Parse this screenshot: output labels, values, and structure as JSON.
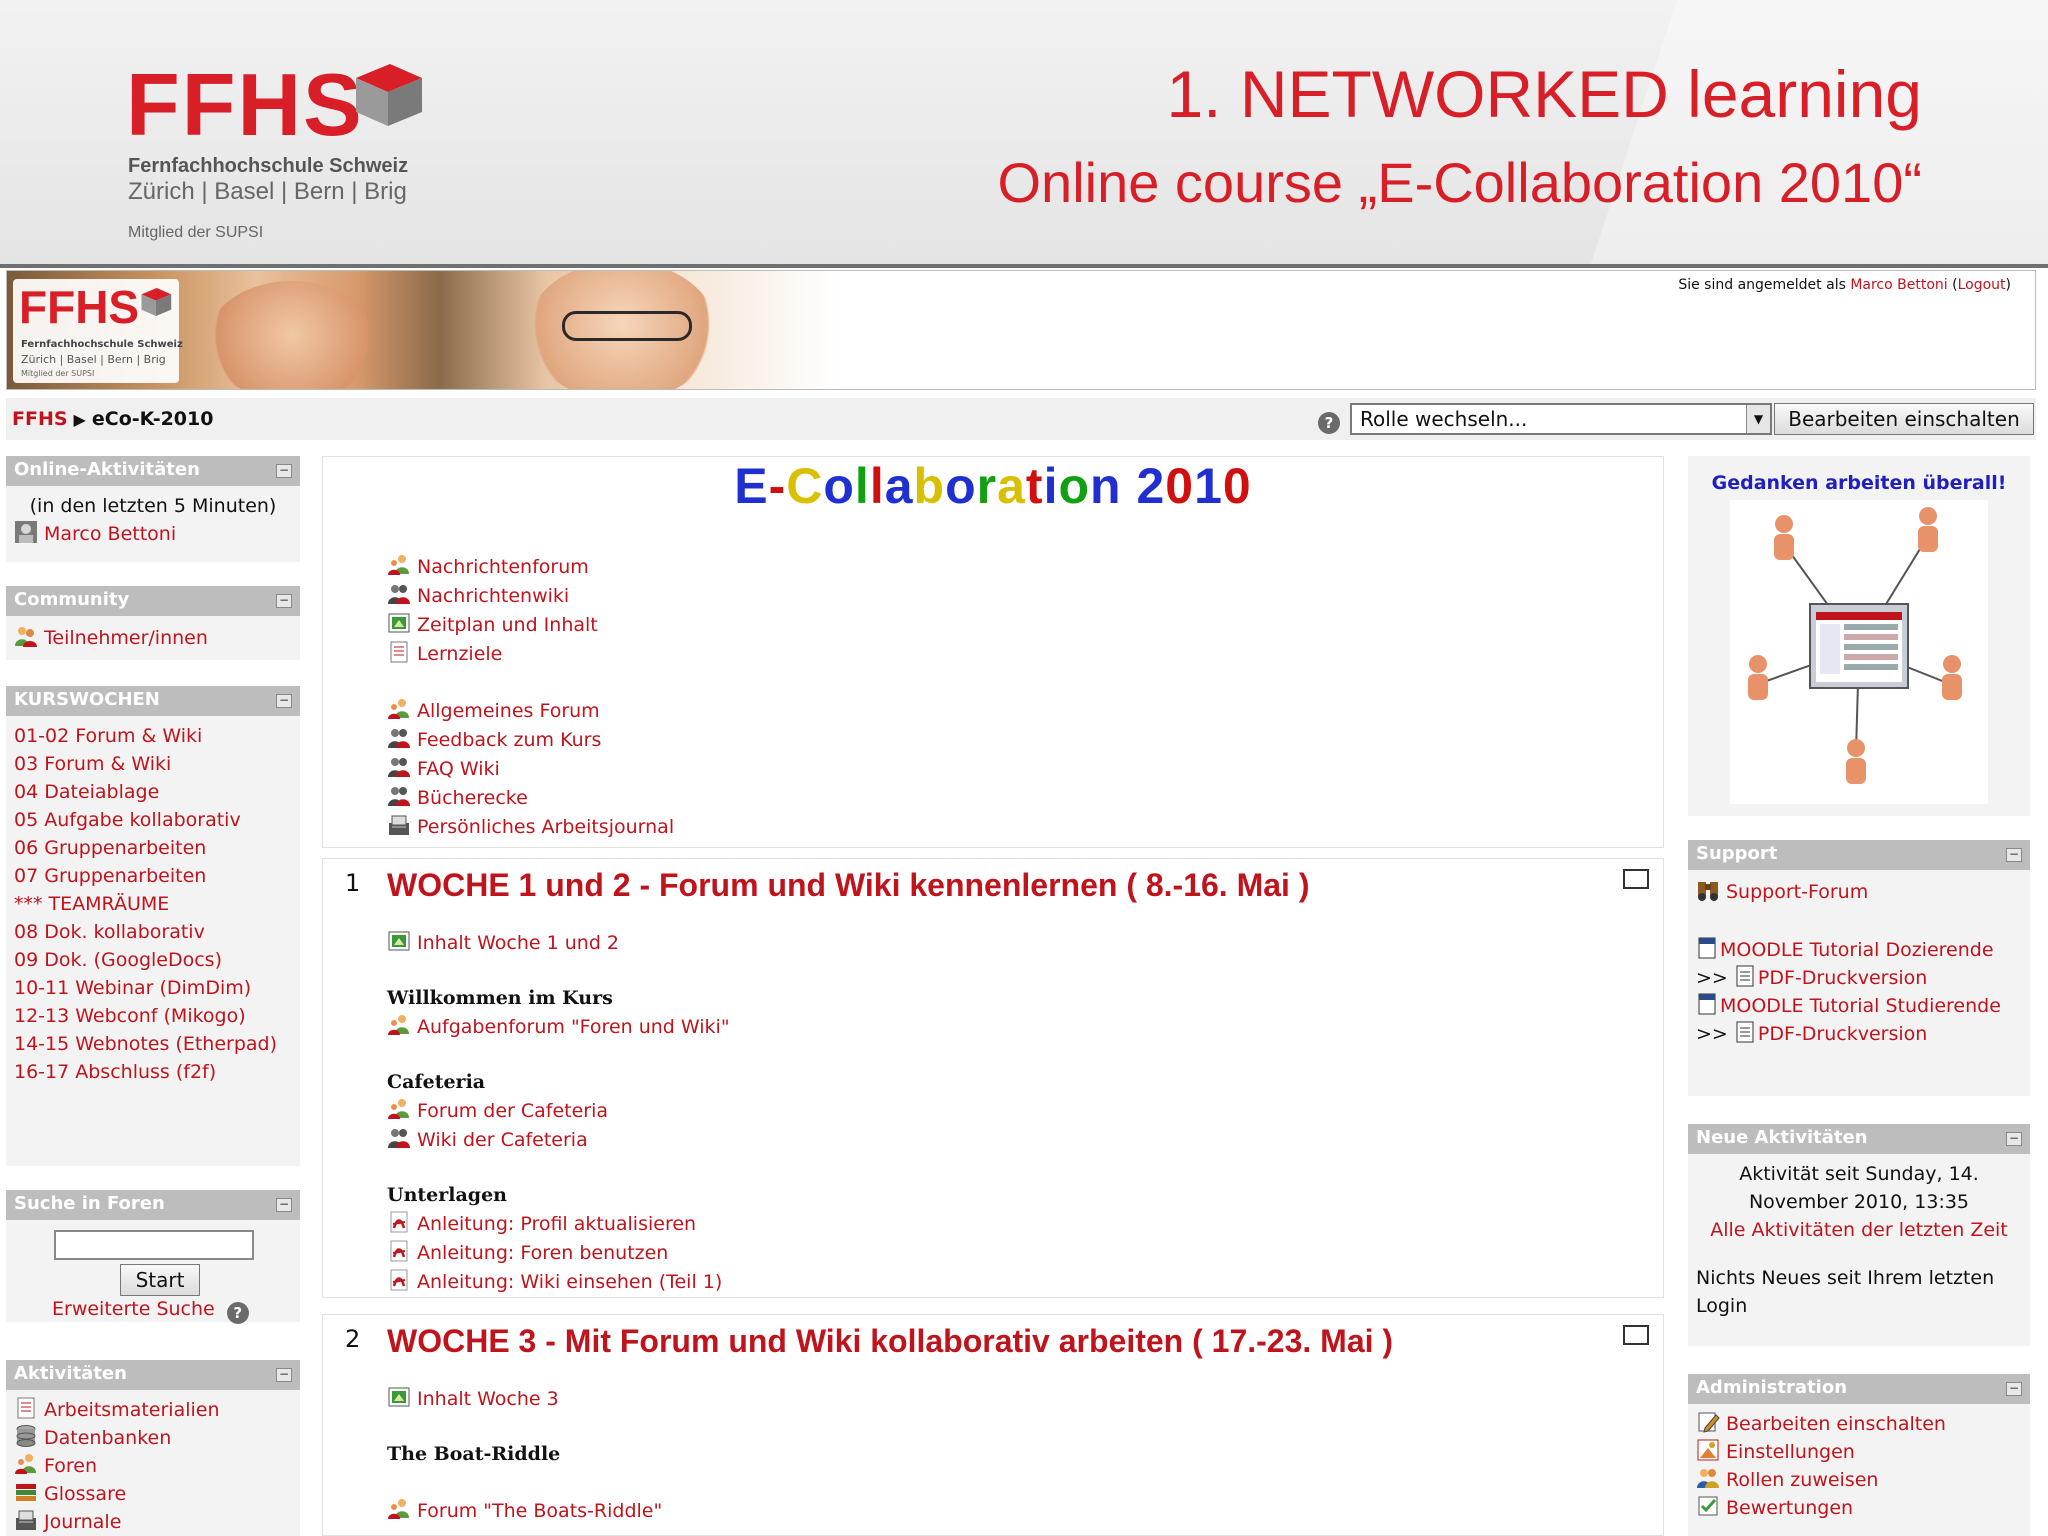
{
  "slide": {
    "logo": {
      "word": "FFHS",
      "school": "Fernfachhochschule Schweiz",
      "cities": "Zürich | Basel | Bern | Brig",
      "member": "Mitglied der SUPSI"
    },
    "title": "1. NETWORKED learning",
    "subtitle": "Online course „E-Collaboration 2010“"
  },
  "banner": {
    "logo": {
      "word": "FFHS",
      "school": "Fernfachhochschule Schweiz",
      "cities": "Zürich | Basel | Bern | Brig",
      "member": "Mitglied der SUPSI"
    },
    "login_prefix": "Sie sind angemeldet als ",
    "login_user": "Marco Bettoni",
    "login_open": " (",
    "logout": "Logout",
    "login_close": ")"
  },
  "nav": {
    "home": "FFHS",
    "current": "eCo-K-2010",
    "role_select": "Rolle wechseln...",
    "edit_button": "Bearbeiten einschalten"
  },
  "left": {
    "online": {
      "title": "Online-Aktivitäten",
      "note": "(in den letzten 5 Minuten)",
      "user": "Marco Bettoni"
    },
    "community": {
      "title": "Community",
      "items": [
        "Teilnehmer/innen"
      ]
    },
    "weeks": {
      "title": "KURSWOCHEN",
      "items": [
        "01-02 Forum & Wiki",
        "03 Forum & Wiki",
        "04 Dateiablage",
        "05 Aufgabe kollaborativ",
        "06 Gruppenarbeiten",
        "07 Gruppenarbeiten",
        "*** TEAMRÄUME",
        "08 Dok. kollaborativ",
        "09 Dok. (GoogleDocs)",
        "10-11 Webinar (DimDim)",
        "12-13 Webconf (Mikogo)",
        "14-15 Webnotes (Etherpad)",
        "16-17 Abschluss (f2f)"
      ]
    },
    "search": {
      "title": "Suche in Foren",
      "input": "",
      "button": "Start",
      "advanced": "Erweiterte Suche"
    },
    "activities": {
      "title": "Aktivitäten",
      "items": [
        "Arbeitsmaterialien",
        "Datenbanken",
        "Foren",
        "Glossare",
        "Journale"
      ]
    }
  },
  "center": {
    "course_title_letters": [
      {
        "ch": "E",
        "color": "#2030d0"
      },
      {
        "ch": "-",
        "color": "#d01010"
      },
      {
        "ch": "C",
        "color": "#d8c000"
      },
      {
        "ch": "o",
        "color": "#2030d0"
      },
      {
        "ch": "l",
        "color": "#10a010"
      },
      {
        "ch": "l",
        "color": "#d01010"
      },
      {
        "ch": "a",
        "color": "#2030d0"
      },
      {
        "ch": "b",
        "color": "#d8c000"
      },
      {
        "ch": "o",
        "color": "#2030d0"
      },
      {
        "ch": "r",
        "color": "#10a010"
      },
      {
        "ch": "a",
        "color": "#d8c000"
      },
      {
        "ch": "t",
        "color": "#d01010"
      },
      {
        "ch": "i",
        "color": "#2030d0"
      },
      {
        "ch": "o",
        "color": "#10a010"
      },
      {
        "ch": "n",
        "color": "#2030d0"
      },
      {
        "ch": " ",
        "color": "#000000"
      },
      {
        "ch": "2",
        "color": "#2030d0"
      },
      {
        "ch": "0",
        "color": "#d01010"
      },
      {
        "ch": "1",
        "color": "#2030d0"
      },
      {
        "ch": "0",
        "color": "#d01010"
      }
    ],
    "top_group1": [
      {
        "icon": "forum",
        "label": "Nachrichtenforum"
      },
      {
        "icon": "wiki",
        "label": "Nachrichtenwiki"
      },
      {
        "icon": "page",
        "label": "Zeitplan und Inhalt"
      },
      {
        "icon": "doc",
        "label": "Lernziele"
      }
    ],
    "top_group2": [
      {
        "icon": "forum",
        "label": "Allgemeines Forum"
      },
      {
        "icon": "wiki",
        "label": "Feedback zum Kurs"
      },
      {
        "icon": "wiki",
        "label": "FAQ Wiki"
      },
      {
        "icon": "wiki",
        "label": "Bücherecke"
      },
      {
        "icon": "journal",
        "label": "Persönliches Arbeitsjournal"
      }
    ],
    "weeks": [
      {
        "num": "1",
        "title": "WOCHE 1 und 2 - Forum und Wiki kennenlernen ( 8.-16. Mai )",
        "intro": {
          "icon": "page",
          "label": "Inhalt Woche 1 und 2"
        },
        "sections": [
          {
            "label": "Willkommen im Kurs",
            "items": [
              {
                "icon": "forum",
                "label": "Aufgabenforum \"Foren und Wiki\""
              }
            ]
          },
          {
            "label": "Cafeteria",
            "items": [
              {
                "icon": "forum",
                "label": "Forum der Cafeteria"
              },
              {
                "icon": "wiki",
                "label": "Wiki der Cafeteria"
              }
            ]
          },
          {
            "label": "Unterlagen",
            "items": [
              {
                "icon": "pdf",
                "label": "Anleitung: Profil aktualisieren"
              },
              {
                "icon": "pdf",
                "label": "Anleitung: Foren benutzen"
              },
              {
                "icon": "pdf",
                "label": "Anleitung: Wiki einsehen (Teil 1)"
              }
            ]
          }
        ]
      },
      {
        "num": "2",
        "title": "WOCHE 3 - Mit Forum und Wiki kollaborativ arbeiten ( 17.-23. Mai )",
        "intro": {
          "icon": "page",
          "label": "Inhalt Woche 3"
        },
        "sections": [
          {
            "label": "The Boat-Riddle",
            "items": [
              {
                "icon": "forum",
                "label": "Forum \"The Boats-Riddle\""
              }
            ]
          }
        ]
      }
    ]
  },
  "right": {
    "gedanken_title": "Gedanken arbeiten überall!",
    "support": {
      "title": "Support",
      "forum": "Support-Forum",
      "tut1": "MOODLE Tutorial Dozierende",
      "pdf1_prefix": ">> ",
      "pdf1": "PDF-Druckversion",
      "tut2": "MOODLE Tutorial Studierende",
      "pdf2_prefix": ">> ",
      "pdf2": "PDF-Druckversion"
    },
    "news": {
      "title": "Neue Aktivitäten",
      "since_line1": "Aktivität seit Sunday, 14.",
      "since_line2": "November 2010, 13:35",
      "all_link": "Alle Aktivitäten der letzten Zeit",
      "nothing_line1": "Nichts Neues seit Ihrem letzten",
      "nothing_line2": "Login"
    },
    "admin": {
      "title": "Administration",
      "items": [
        {
          "icon": "edit",
          "label": "Bearbeiten einschalten"
        },
        {
          "icon": "settings",
          "label": "Einstellungen"
        },
        {
          "icon": "roles",
          "label": "Rollen zuweisen"
        },
        {
          "icon": "grades",
          "label": "Bewertungen"
        }
      ]
    }
  },
  "colors": {
    "brand_red": "#d81e27",
    "link_red": "#c0141c",
    "block_header": "#bdbdbd",
    "block_bg": "#f3f3f3",
    "gedanken_blue": "#2020c0"
  }
}
